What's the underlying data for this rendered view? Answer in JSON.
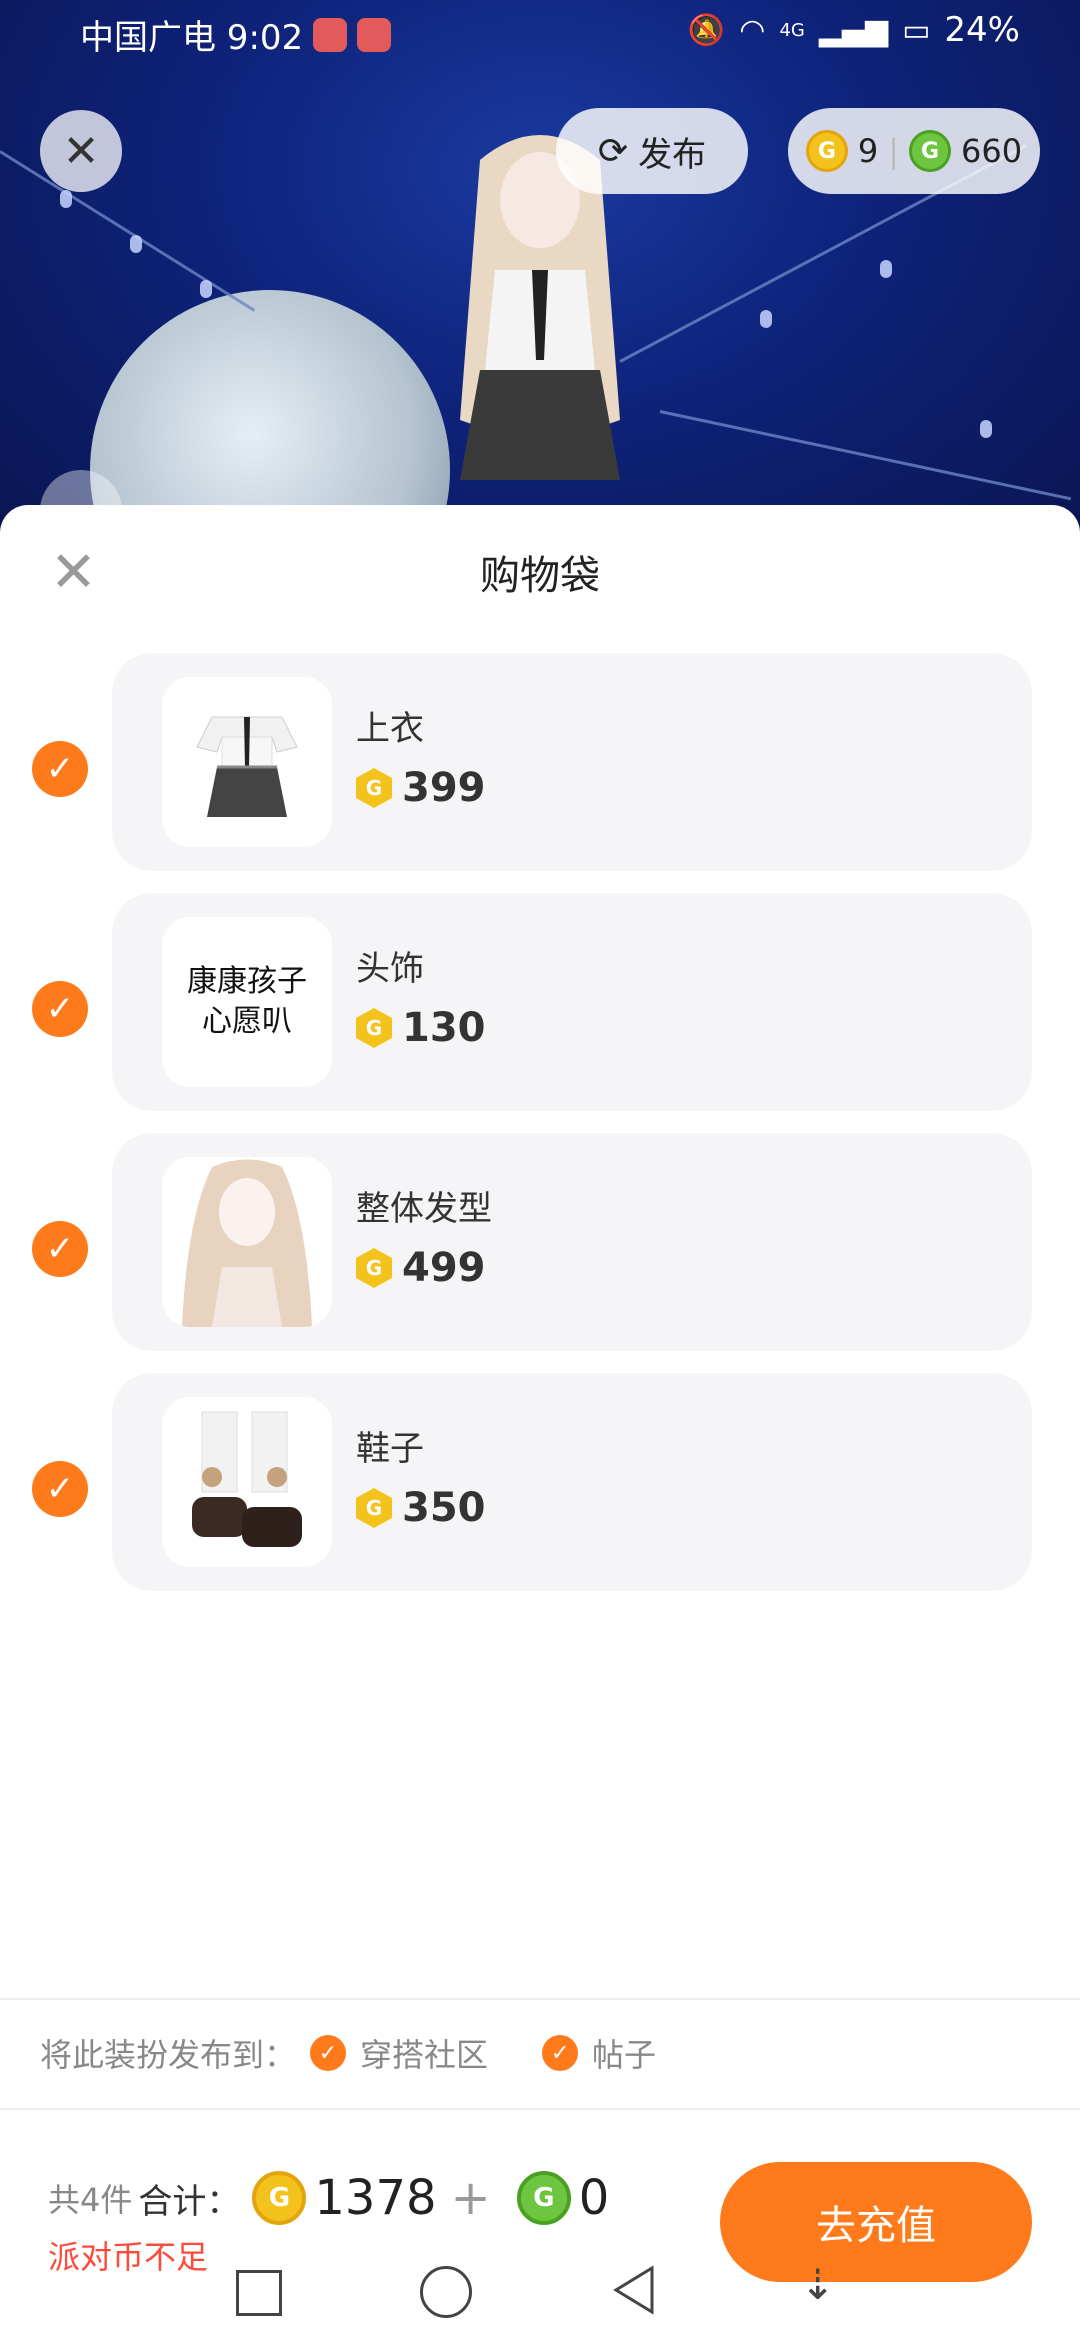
{
  "status_bar": {
    "carrier_time": "中国广电 9:02",
    "network": "4G",
    "battery": "24%"
  },
  "top_overlay": {
    "publish_label": "发布",
    "gold_balance": "9",
    "green_balance": "660"
  },
  "sheet": {
    "title": "购物袋",
    "items": [
      {
        "name": "上衣",
        "price": "399",
        "checked": true
      },
      {
        "name": "头饰",
        "price": "130",
        "checked": true,
        "thumb_text_1": "康康孩子",
        "thumb_text_2": "心愿叭"
      },
      {
        "name": "整体发型",
        "price": "499",
        "checked": true
      },
      {
        "name": "鞋子",
        "price": "350",
        "checked": true
      }
    ],
    "publish_to_label": "将此装扮发布到：",
    "publish_option_1": "穿搭社区",
    "publish_option_2": "帖子",
    "count_label": "共4件",
    "total_label": "合计：",
    "gold_total": "1378",
    "plus": "+",
    "green_total": "0",
    "insufficient": "派对币不足",
    "recharge_label": "去充值"
  },
  "colors": {
    "accent": "#ff7a1a",
    "gold_coin": "#f4c21c",
    "green_coin": "#6ec540",
    "warning": "#ff4a3a"
  },
  "icons": [
    "close-icon",
    "publish-icon",
    "gold-coin-icon",
    "green-coin-icon",
    "check-icon",
    "nav-square-icon",
    "nav-home-icon",
    "nav-back-icon",
    "nav-down-icon"
  ]
}
